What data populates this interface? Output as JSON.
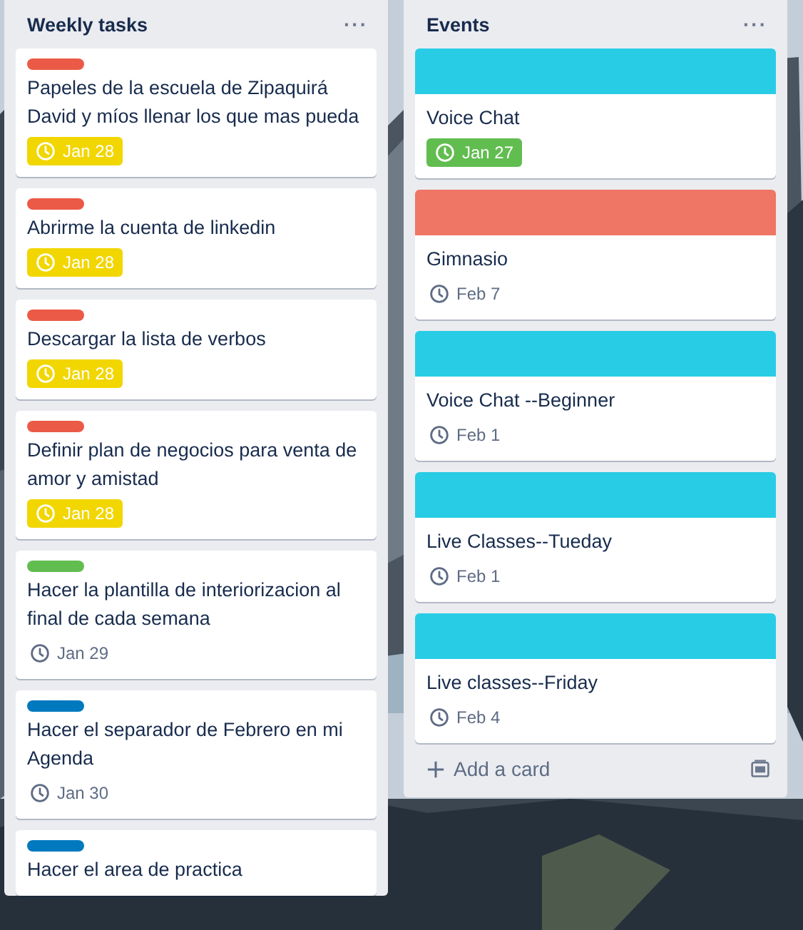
{
  "lists": [
    {
      "title": "Weekly tasks",
      "menu": "···",
      "cards": [
        {
          "label": {
            "color": "#eb5a46"
          },
          "title": "Papeles de la escuela de Zipaquirá David y míos llenar los que mas pueda",
          "due": {
            "text": "Jan 28",
            "kind": "soon"
          }
        },
        {
          "label": {
            "color": "#eb5a46"
          },
          "title": "Abrirme la cuenta de linkedin",
          "due": {
            "text": "Jan 28",
            "kind": "soon"
          }
        },
        {
          "label": {
            "color": "#eb5a46"
          },
          "title": "Descargar la lista de verbos",
          "due": {
            "text": "Jan 28",
            "kind": "soon"
          }
        },
        {
          "label": {
            "color": "#eb5a46"
          },
          "title": "Definir plan de negocios para venta de amor y amistad",
          "due": {
            "text": "Jan 28",
            "kind": "soon"
          }
        },
        {
          "label": {
            "color": "#61bd4f"
          },
          "title": "Hacer la plantilla de interiorizacion al final de cada semana",
          "due": {
            "text": "Jan 29",
            "kind": "plain"
          }
        },
        {
          "label": {
            "color": "#0079bf"
          },
          "title": "Hacer el separador de Febrero en mi Agenda",
          "due": {
            "text": "Jan 30",
            "kind": "plain"
          }
        },
        {
          "label": {
            "color": "#0079bf"
          },
          "title": "Hacer el area de practica"
        }
      ]
    },
    {
      "title": "Events",
      "menu": "···",
      "add_card": "Add a card",
      "cards": [
        {
          "cover": {
            "color": "#29cce5"
          },
          "title": "Voice Chat",
          "due": {
            "text": "Jan 27",
            "kind": "complete"
          }
        },
        {
          "cover": {
            "color": "#ef7564"
          },
          "title": "Gimnasio",
          "due": {
            "text": "Feb 7",
            "kind": "plain"
          }
        },
        {
          "cover": {
            "color": "#29cce5"
          },
          "title": "Voice Chat --Beginner",
          "due": {
            "text": "Feb 1",
            "kind": "plain"
          }
        },
        {
          "cover": {
            "color": "#29cce5"
          },
          "title": "Live Classes--Tueday",
          "due": {
            "text": "Feb 1",
            "kind": "plain"
          }
        },
        {
          "cover": {
            "color": "#29cce5"
          },
          "title": "Live classes--Friday",
          "due": {
            "text": "Feb 4",
            "kind": "plain"
          }
        }
      ]
    }
  ]
}
